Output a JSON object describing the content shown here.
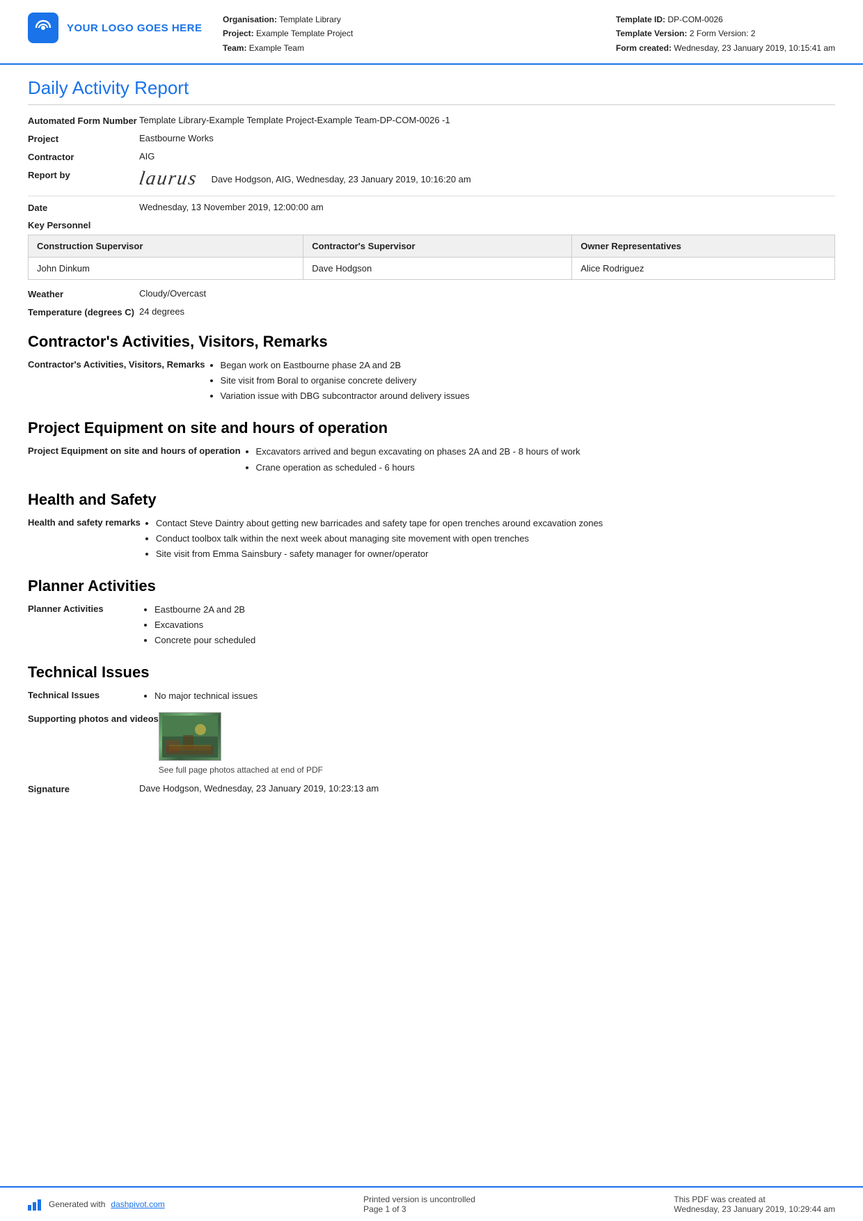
{
  "header": {
    "logo_text": "YOUR LOGO GOES HERE",
    "organisation_label": "Organisation:",
    "organisation_value": "Template Library",
    "project_label": "Project:",
    "project_value": "Example Template Project",
    "team_label": "Team:",
    "team_value": "Example Team",
    "template_id_label": "Template ID:",
    "template_id_value": "DP-COM-0026",
    "template_version_label": "Template Version:",
    "template_version_value": "2 Form Version: 2",
    "form_created_label": "Form created:",
    "form_created_value": "Wednesday, 23 January 2019, 10:15:41 am"
  },
  "report": {
    "title": "Daily Activity Report",
    "form_number_label": "Automated Form Number",
    "form_number_value": "Template Library-Example Template Project-Example Team-DP-COM-0026   -1",
    "project_label": "Project",
    "project_value": "Eastbourne Works",
    "contractor_label": "Contractor",
    "contractor_value": "AIG",
    "report_by_label": "Report by",
    "report_by_signer": "Dave Hodgson, AIG, Wednesday, 23 January 2019, 10:16:20 am",
    "date_label": "Date",
    "date_value": "Wednesday, 13 November 2019, 12:00:00 am",
    "key_personnel_label": "Key Personnel",
    "personnel_table": {
      "headers": [
        "Construction Supervisor",
        "Contractor's Supervisor",
        "Owner Representatives"
      ],
      "rows": [
        [
          "John Dinkum",
          "Dave Hodgson",
          "Alice Rodriguez"
        ]
      ]
    },
    "weather_label": "Weather",
    "weather_value": "Cloudy/Overcast",
    "temperature_label": "Temperature (degrees C)",
    "temperature_value": "24 degrees"
  },
  "sections": {
    "activities": {
      "heading": "Contractor's Activities, Visitors, Remarks",
      "label": "Contractor's Activities, Visitors, Remarks",
      "items": [
        "Began work on Eastbourne phase 2A and 2B",
        "Site visit from Boral to organise concrete delivery",
        "Variation issue with DBG subcontractor around delivery issues"
      ]
    },
    "equipment": {
      "heading": "Project Equipment on site and hours of operation",
      "label": "Project Equipment on site and hours of operation",
      "items": [
        "Excavators arrived and begun excavating on phases 2A and 2B - 8 hours of work",
        "Crane operation as scheduled - 6 hours"
      ]
    },
    "health_safety": {
      "heading": "Health and Safety",
      "label": "Health and safety remarks",
      "items": [
        "Contact Steve Daintry about getting new barricades and safety tape for open trenches around excavation zones",
        "Conduct toolbox talk within the next week about managing site movement with open trenches",
        "Site visit from Emma Sainsbury - safety manager for owner/operator"
      ]
    },
    "planner": {
      "heading": "Planner Activities",
      "label": "Planner Activities",
      "items": [
        "Eastbourne 2A and 2B",
        "Excavations",
        "Concrete pour scheduled"
      ]
    },
    "technical": {
      "heading": "Technical Issues",
      "label": "Technical Issues",
      "items": [
        "No major technical issues"
      ]
    },
    "supporting": {
      "label": "Supporting photos and videos",
      "caption": "See full page photos attached at end of PDF"
    },
    "signature": {
      "label": "Signature",
      "value": "Dave Hodgson, Wednesday, 23 January 2019, 10:23:13 am"
    }
  },
  "footer": {
    "generated_text": "Generated with ",
    "link_text": "dashpivot.com",
    "uncontrolled_text": "Printed version is uncontrolled",
    "page_text": "Page 1 of 3",
    "pdf_created_label": "This PDF was created at",
    "pdf_created_value": "Wednesday, 23 January 2019, 10:29:44 am"
  }
}
